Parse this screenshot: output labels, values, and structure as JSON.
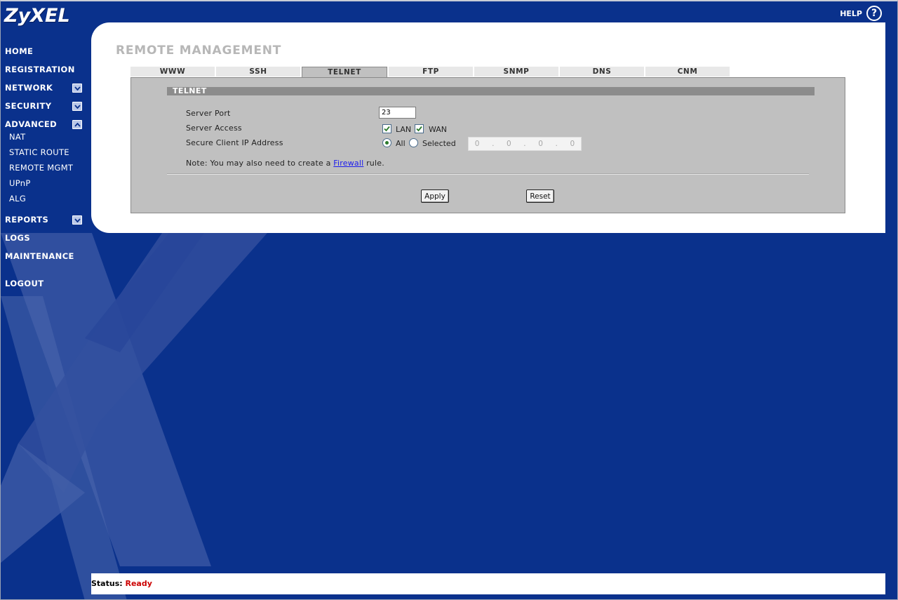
{
  "brand": {
    "logo": "ZyXEL",
    "help_label": "HELP",
    "help_glyph": "?"
  },
  "nav": {
    "items": [
      {
        "label": "HOME"
      },
      {
        "label": "REGISTRATION"
      },
      {
        "label": "NETWORK",
        "arrow": "down"
      },
      {
        "label": "SECURITY",
        "arrow": "down"
      },
      {
        "label": "ADVANCED",
        "arrow": "up"
      },
      {
        "label": "REPORTS",
        "arrow": "down"
      },
      {
        "label": "LOGS"
      },
      {
        "label": "MAINTENANCE"
      },
      {
        "label": "LOGOUT"
      }
    ],
    "advanced_sub": [
      {
        "label": "NAT"
      },
      {
        "label": "STATIC ROUTE"
      },
      {
        "label": "REMOTE MGMT"
      },
      {
        "label": "UPnP"
      },
      {
        "label": "ALG"
      }
    ]
  },
  "page": {
    "title": "REMOTE MANAGEMENT",
    "tabs": [
      {
        "label": "WWW"
      },
      {
        "label": "SSH"
      },
      {
        "label": "TELNET",
        "active": true
      },
      {
        "label": "FTP"
      },
      {
        "label": "SNMP"
      },
      {
        "label": "DNS"
      },
      {
        "label": "CNM"
      }
    ],
    "section_title": "TELNET",
    "fields": {
      "server_port_label": "Server Port",
      "server_port_value": "23",
      "server_access_label": "Server Access",
      "lan_label": "LAN",
      "lan_checked": true,
      "wan_label": "WAN",
      "wan_checked": true,
      "secure_client_label": "Secure Client IP Address",
      "all_label": "All",
      "all_selected": true,
      "selected_label": "Selected",
      "ip_octets": [
        "0",
        "0",
        "0",
        "0"
      ]
    },
    "note_prefix": "Note: You may also need to create a ",
    "note_link": "Firewall",
    "note_suffix": " rule.",
    "apply_label": "Apply",
    "reset_label": "Reset"
  },
  "status": {
    "label": "Status:",
    "value": "Ready"
  },
  "colors": {
    "background": "#0a318c",
    "accent_panel": "#ffffff",
    "status_value": "#cc0000"
  }
}
